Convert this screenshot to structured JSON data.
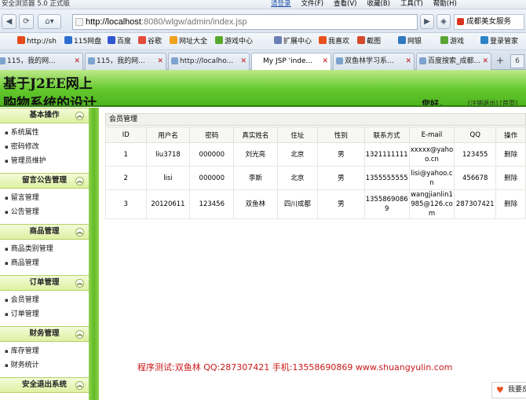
{
  "browser": {
    "window_title": "安全浏览器 5.0 正式版",
    "menu": {
      "login": "请登录",
      "file": "文件(F)",
      "view": "查看(V)",
      "favorites": "收藏(B)",
      "tools": "工具(T)",
      "help": "帮助(H)"
    },
    "address": {
      "host": "http://localhost",
      "rest": ":8080/wlgw/admin/index.jsp"
    },
    "quick_link": "成都美女服务",
    "favorites_bar": [
      {
        "label": "http://sh",
        "color": "#e64a19"
      },
      {
        "label": "115网盘",
        "color": "#2d6fd1"
      },
      {
        "label": "百度",
        "color": "#3157d1"
      },
      {
        "label": "谷歌",
        "color": "#e24c3b"
      },
      {
        "label": "网址大全",
        "color": "#f0a21a"
      },
      {
        "label": "游戏中心",
        "color": "#56a82c"
      },
      {
        "label": "扩展中心",
        "color": "#6b7fb6"
      },
      {
        "label": "我喜欢",
        "color": "#e8521f"
      },
      {
        "label": "截图",
        "color": "#d54a2a"
      },
      {
        "label": "网银",
        "color": "#2f79c3"
      },
      {
        "label": "游戏",
        "color": "#5aa533"
      },
      {
        "label": "登录管家",
        "color": "#2d84c7"
      }
    ],
    "tabs": [
      {
        "label": "115，我的网...",
        "active": false
      },
      {
        "label": "115，我的网...",
        "active": false
      },
      {
        "label": "http://localho...",
        "active": false
      },
      {
        "label": "My JSP 'inde...",
        "active": true
      },
      {
        "label": "双鱼林学习系...",
        "active": false
      },
      {
        "label": "百度搜索_成都...",
        "active": false
      }
    ],
    "tab_count": "6",
    "new_tab": "+"
  },
  "header": {
    "title_line1": "基于J2EE网上",
    "title_line2": "购物系统的设计",
    "greeting": "您好，",
    "links": "[注销退出] [首页]"
  },
  "sidebar": {
    "groups": [
      {
        "title": "基本操作",
        "items": [
          "系统属性",
          "密码修改",
          "管理员维护"
        ]
      },
      {
        "title": "留言公告管理",
        "items": [
          "留言管理",
          "公告管理"
        ]
      },
      {
        "title": "商品管理",
        "items": [
          "商品类别管理",
          "商品管理"
        ]
      },
      {
        "title": "订单管理",
        "items": [
          "会员管理",
          "订单管理"
        ]
      },
      {
        "title": "财务管理",
        "items": [
          "库存管理",
          "财务统计"
        ]
      },
      {
        "title": "安全退出系统",
        "items": []
      }
    ]
  },
  "main": {
    "panel_title": "会员管理",
    "columns": [
      "ID",
      "用户名",
      "密码",
      "真实姓名",
      "住址",
      "性别",
      "联系方式",
      "E-mail",
      "QQ",
      "操作"
    ],
    "rows": [
      [
        "1",
        "liu3718",
        "000000",
        "刘光亮",
        "北京",
        "男",
        "1321111111",
        "xxxxx@yahoo.cn",
        "123455",
        "删除"
      ],
      [
        "2",
        "lisi",
        "000000",
        "李斯",
        "北京",
        "男",
        "1355555555",
        "lisi@yahoo.cn",
        "456678",
        "删除"
      ],
      [
        "3",
        "20120611",
        "123456",
        "双鱼林",
        "四川成都",
        "男",
        "13558690869",
        "wangjianlin1985@126.com",
        "287307421",
        "删除"
      ]
    ]
  },
  "footer": "程序测试:双鱼林 QQ:287307421 手机:13558690869 www.shuangyulin.com",
  "feedback": "我要反馈"
}
